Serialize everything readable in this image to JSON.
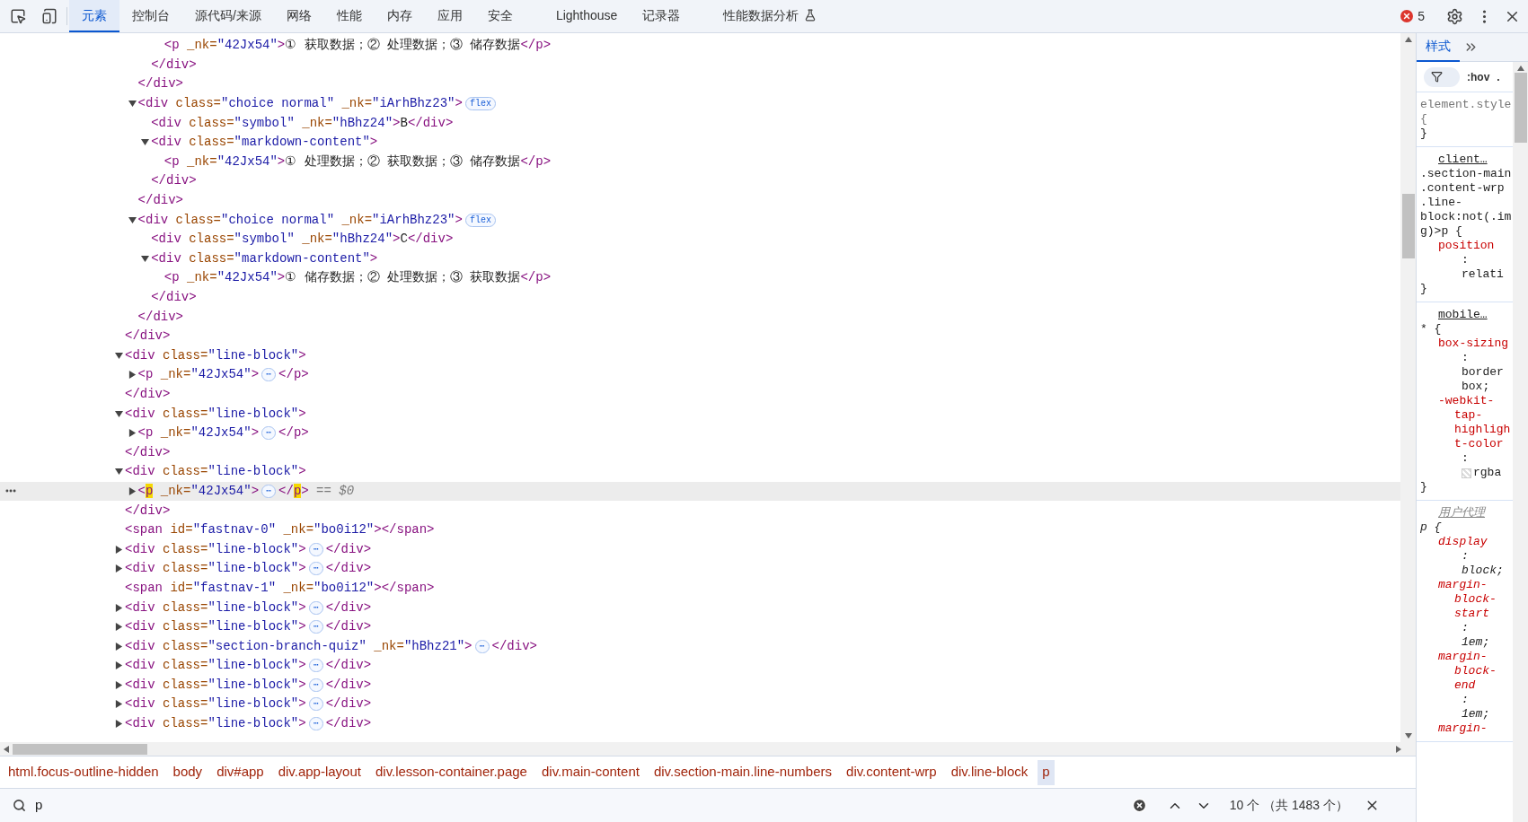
{
  "toolbar": {
    "tabs": [
      {
        "label": "元素",
        "selected": true
      },
      {
        "label": "控制台",
        "selected": false
      },
      {
        "label": "源代码/来源",
        "selected": false
      },
      {
        "label": "网络",
        "selected": false
      },
      {
        "label": "性能",
        "selected": false
      },
      {
        "label": "内存",
        "selected": false
      },
      {
        "label": "应用",
        "selected": false
      },
      {
        "label": "安全",
        "selected": false
      },
      {
        "label": "Lighthouse",
        "selected": false
      },
      {
        "label": "记录器",
        "selected": false
      },
      {
        "label": "性能数据分析",
        "selected": false,
        "experimental": true
      }
    ],
    "error_count": "5"
  },
  "tree": [
    {
      "children": [
        {
          "children": [
            {
              "children": [
                {
                  "selected": false,
                  "tokens": [
                    {
                      "kind": "tag",
                      "text": "<p"
                    },
                    {
                      "kind": "attr",
                      "text": " _nk="
                    },
                    {
                      "kind": "value",
                      "text": "\"42Jx54\""
                    },
                    {
                      "kind": "tag",
                      "text": ">"
                    },
                    {
                      "kind": "text",
                      "text": "① 获取数据；② 处理数据；③ 储存数据"
                    },
                    {
                      "kind": "tag",
                      "text": "</p>"
                    }
                  ]
                }
              ]
            },
            {
              "selected": false,
              "tokens": [
                {
                  "kind": "tag",
                  "text": "</div>"
                }
              ]
            }
          ]
        },
        {
          "selected": false,
          "tokens": [
            {
              "kind": "tag",
              "text": "</div>"
            }
          ]
        },
        {
          "selected": false,
          "expanded": true,
          "tokens": [
            {
              "kind": "tag",
              "text": "<div"
            },
            {
              "kind": "attr",
              "text": " class="
            },
            {
              "kind": "value",
              "text": "\"choice normal\""
            },
            {
              "kind": "attr",
              "text": " _nk="
            },
            {
              "kind": "value",
              "text": "\"iArhBhz23\""
            },
            {
              "kind": "tag",
              "text": ">"
            },
            {
              "kind": "badge",
              "text": "flex"
            }
          ],
          "children": [
            {
              "selected": false,
              "tokens": [
                {
                  "kind": "tag",
                  "text": "<div"
                },
                {
                  "kind": "attr",
                  "text": " class="
                },
                {
                  "kind": "value",
                  "text": "\"symbol\""
                },
                {
                  "kind": "attr",
                  "text": " _nk="
                },
                {
                  "kind": "value",
                  "text": "\"hBhz24\""
                },
                {
                  "kind": "tag",
                  "text": ">"
                },
                {
                  "kind": "text",
                  "text": "B"
                },
                {
                  "kind": "tag",
                  "text": "</div>"
                }
              ]
            },
            {
              "selected": false,
              "expanded": true,
              "tokens": [
                {
                  "kind": "tag",
                  "text": "<div"
                },
                {
                  "kind": "attr",
                  "text": " class="
                },
                {
                  "kind": "value",
                  "text": "\"markdown-content\""
                },
                {
                  "kind": "tag",
                  "text": ">"
                }
              ],
              "children": [
                {
                  "selected": false,
                  "tokens": [
                    {
                      "kind": "tag",
                      "text": "<p"
                    },
                    {
                      "kind": "attr",
                      "text": " _nk="
                    },
                    {
                      "kind": "value",
                      "text": "\"42Jx54\""
                    },
                    {
                      "kind": "tag",
                      "text": ">"
                    },
                    {
                      "kind": "text",
                      "text": "① 处理数据；② 获取数据；③ 储存数据"
                    },
                    {
                      "kind": "tag",
                      "text": "</p>"
                    }
                  ]
                }
              ]
            },
            {
              "selected": false,
              "tokens": [
                {
                  "kind": "tag",
                  "text": "</div>"
                }
              ]
            }
          ]
        },
        {
          "selected": false,
          "tokens": [
            {
              "kind": "tag",
              "text": "</div>"
            }
          ]
        },
        {
          "selected": false,
          "expanded": true,
          "tokens": [
            {
              "kind": "tag",
              "text": "<div"
            },
            {
              "kind": "attr",
              "text": " class="
            },
            {
              "kind": "value",
              "text": "\"choice normal\""
            },
            {
              "kind": "attr",
              "text": " _nk="
            },
            {
              "kind": "value",
              "text": "\"iArhBhz23\""
            },
            {
              "kind": "tag",
              "text": ">"
            },
            {
              "kind": "badge",
              "text": "flex"
            }
          ],
          "children": [
            {
              "selected": false,
              "tokens": [
                {
                  "kind": "tag",
                  "text": "<div"
                },
                {
                  "kind": "attr",
                  "text": " class="
                },
                {
                  "kind": "value",
                  "text": "\"symbol\""
                },
                {
                  "kind": "attr",
                  "text": " _nk="
                },
                {
                  "kind": "value",
                  "text": "\"hBhz24\""
                },
                {
                  "kind": "tag",
                  "text": ">"
                },
                {
                  "kind": "text",
                  "text": "C"
                },
                {
                  "kind": "tag",
                  "text": "</div>"
                }
              ]
            },
            {
              "selected": false,
              "expanded": true,
              "tokens": [
                {
                  "kind": "tag",
                  "text": "<div"
                },
                {
                  "kind": "attr",
                  "text": " class="
                },
                {
                  "kind": "value",
                  "text": "\"markdown-content\""
                },
                {
                  "kind": "tag",
                  "text": ">"
                }
              ],
              "children": [
                {
                  "selected": false,
                  "tokens": [
                    {
                      "kind": "tag",
                      "text": "<p"
                    },
                    {
                      "kind": "attr",
                      "text": " _nk="
                    },
                    {
                      "kind": "value",
                      "text": "\"42Jx54\""
                    },
                    {
                      "kind": "tag",
                      "text": ">"
                    },
                    {
                      "kind": "text",
                      "text": "① 储存数据；② 处理数据；③ 获取数据"
                    },
                    {
                      "kind": "tag",
                      "text": "</p>"
                    }
                  ]
                }
              ]
            },
            {
              "selected": false,
              "tokens": [
                {
                  "kind": "tag",
                  "text": "</div>"
                }
              ]
            }
          ]
        },
        {
          "selected": false,
          "tokens": [
            {
              "kind": "tag",
              "text": "</div>"
            }
          ]
        }
      ]
    },
    {
      "selected": false,
      "tokens": [
        {
          "kind": "tag",
          "text": "</div>"
        }
      ]
    },
    {
      "selected": false,
      "expanded": true,
      "tokens": [
        {
          "kind": "tag",
          "text": "<div"
        },
        {
          "kind": "attr",
          "text": " class="
        },
        {
          "kind": "value",
          "text": "\"line-block\""
        },
        {
          "kind": "tag",
          "text": ">"
        }
      ],
      "children": [
        {
          "selected": false,
          "expanded": false,
          "tokens": [
            {
              "kind": "tag",
              "text": "<p"
            },
            {
              "kind": "attr",
              "text": " _nk="
            },
            {
              "kind": "value",
              "text": "\"42Jx54\""
            },
            {
              "kind": "tag",
              "text": ">"
            },
            {
              "kind": "badge",
              "text": "⋯"
            },
            {
              "kind": "tag",
              "text": "</p>"
            }
          ]
        }
      ]
    },
    {
      "selected": false,
      "tokens": [
        {
          "kind": "tag",
          "text": "</div>"
        }
      ]
    },
    {
      "selected": false,
      "expanded": true,
      "tokens": [
        {
          "kind": "tag",
          "text": "<div"
        },
        {
          "kind": "attr",
          "text": " class="
        },
        {
          "kind": "value",
          "text": "\"line-block\""
        },
        {
          "kind": "tag",
          "text": ">"
        }
      ],
      "children": [
        {
          "selected": false,
          "expanded": false,
          "tokens": [
            {
              "kind": "tag",
              "text": "<p"
            },
            {
              "kind": "attr",
              "text": " _nk="
            },
            {
              "kind": "value",
              "text": "\"42Jx54\""
            },
            {
              "kind": "tag",
              "text": ">"
            },
            {
              "kind": "badge",
              "text": "⋯"
            },
            {
              "kind": "tag",
              "text": "</p>"
            }
          ]
        }
      ]
    },
    {
      "selected": false,
      "tokens": [
        {
          "kind": "tag",
          "text": "</div>"
        }
      ]
    },
    {
      "selected": false,
      "expanded": true,
      "tokens": [
        {
          "kind": "tag",
          "text": "<div"
        },
        {
          "kind": "attr",
          "text": " class="
        },
        {
          "kind": "value",
          "text": "\"line-block\""
        },
        {
          "kind": "tag",
          "text": ">"
        }
      ],
      "children": [
        {
          "selected": true,
          "expanded": false,
          "tokens": [
            {
              "kind": "tag",
              "text": "<"
            },
            {
              "kind": "match",
              "text": "p"
            },
            {
              "kind": "attr",
              "text": " _nk="
            },
            {
              "kind": "value",
              "text": "\"42Jx54\""
            },
            {
              "kind": "tag",
              "text": ">"
            },
            {
              "kind": "badge",
              "text": "⋯"
            },
            {
              "kind": "tag",
              "text": "</"
            },
            {
              "kind": "match",
              "text": "p"
            },
            {
              "kind": "tag",
              "text": ">"
            },
            {
              "kind": "note",
              "text": " == $0"
            }
          ]
        }
      ]
    },
    {
      "selected": false,
      "tokens": [
        {
          "kind": "tag",
          "text": "</div>"
        }
      ]
    },
    {
      "selected": false,
      "tokens": [
        {
          "kind": "tag",
          "text": "<span"
        },
        {
          "kind": "attr",
          "text": " id="
        },
        {
          "kind": "value",
          "text": "\"fastnav-0\""
        },
        {
          "kind": "attr",
          "text": " _nk="
        },
        {
          "kind": "value",
          "text": "\"bo0i12\""
        },
        {
          "kind": "tag",
          "text": "></span>"
        }
      ]
    },
    {
      "selected": false,
      "expanded": false,
      "tokens": [
        {
          "kind": "tag",
          "text": "<div"
        },
        {
          "kind": "attr",
          "text": " class="
        },
        {
          "kind": "value",
          "text": "\"line-block\""
        },
        {
          "kind": "tag",
          "text": ">"
        },
        {
          "kind": "badge",
          "text": "⋯"
        },
        {
          "kind": "tag",
          "text": "</div>"
        }
      ]
    },
    {
      "selected": false,
      "expanded": false,
      "tokens": [
        {
          "kind": "tag",
          "text": "<div"
        },
        {
          "kind": "attr",
          "text": " class="
        },
        {
          "kind": "value",
          "text": "\"line-block\""
        },
        {
          "kind": "tag",
          "text": ">"
        },
        {
          "kind": "badge",
          "text": "⋯"
        },
        {
          "kind": "tag",
          "text": "</div>"
        }
      ]
    },
    {
      "selected": false,
      "tokens": [
        {
          "kind": "tag",
          "text": "<span"
        },
        {
          "kind": "attr",
          "text": " id="
        },
        {
          "kind": "value",
          "text": "\"fastnav-1\""
        },
        {
          "kind": "attr",
          "text": " _nk="
        },
        {
          "kind": "value",
          "text": "\"bo0i12\""
        },
        {
          "kind": "tag",
          "text": "></span>"
        }
      ]
    },
    {
      "selected": false,
      "expanded": false,
      "tokens": [
        {
          "kind": "tag",
          "text": "<div"
        },
        {
          "kind": "attr",
          "text": " class="
        },
        {
          "kind": "value",
          "text": "\"line-block\""
        },
        {
          "kind": "tag",
          "text": ">"
        },
        {
          "kind": "badge",
          "text": "⋯"
        },
        {
          "kind": "tag",
          "text": "</div>"
        }
      ]
    },
    {
      "selected": false,
      "expanded": false,
      "tokens": [
        {
          "kind": "tag",
          "text": "<div"
        },
        {
          "kind": "attr",
          "text": " class="
        },
        {
          "kind": "value",
          "text": "\"line-block\""
        },
        {
          "kind": "tag",
          "text": ">"
        },
        {
          "kind": "badge",
          "text": "⋯"
        },
        {
          "kind": "tag",
          "text": "</div>"
        }
      ]
    },
    {
      "selected": false,
      "expanded": false,
      "tokens": [
        {
          "kind": "tag",
          "text": "<div"
        },
        {
          "kind": "attr",
          "text": " class="
        },
        {
          "kind": "value",
          "text": "\"section-branch-quiz\""
        },
        {
          "kind": "attr",
          "text": " _nk="
        },
        {
          "kind": "value",
          "text": "\"hBhz21\""
        },
        {
          "kind": "tag",
          "text": ">"
        },
        {
          "kind": "badge",
          "text": "⋯"
        },
        {
          "kind": "tag",
          "text": "</div>"
        }
      ]
    },
    {
      "selected": false,
      "expanded": false,
      "tokens": [
        {
          "kind": "tag",
          "text": "<div"
        },
        {
          "kind": "attr",
          "text": " class="
        },
        {
          "kind": "value",
          "text": "\"line-block\""
        },
        {
          "kind": "tag",
          "text": ">"
        },
        {
          "kind": "badge",
          "text": "⋯"
        },
        {
          "kind": "tag",
          "text": "</div>"
        }
      ]
    },
    {
      "selected": false,
      "expanded": false,
      "tokens": [
        {
          "kind": "tag",
          "text": "<div"
        },
        {
          "kind": "attr",
          "text": " class="
        },
        {
          "kind": "value",
          "text": "\"line-block\""
        },
        {
          "kind": "tag",
          "text": ">"
        },
        {
          "kind": "badge",
          "text": "⋯"
        },
        {
          "kind": "tag",
          "text": "</div>"
        }
      ]
    },
    {
      "selected": false,
      "expanded": false,
      "tokens": [
        {
          "kind": "tag",
          "text": "<div"
        },
        {
          "kind": "attr",
          "text": " class="
        },
        {
          "kind": "value",
          "text": "\"line-block\""
        },
        {
          "kind": "tag",
          "text": ">"
        },
        {
          "kind": "badge",
          "text": "⋯"
        },
        {
          "kind": "tag",
          "text": "</div>"
        }
      ]
    },
    {
      "selected": false,
      "expanded": false,
      "tokens": [
        {
          "kind": "tag",
          "text": "<div"
        },
        {
          "kind": "attr",
          "text": " class="
        },
        {
          "kind": "value",
          "text": "\"line-block\""
        },
        {
          "kind": "tag",
          "text": ">"
        },
        {
          "kind": "badge",
          "text": "⋯"
        },
        {
          "kind": "tag",
          "text": "</div>"
        }
      ]
    }
  ],
  "styles": {
    "tabs": [
      {
        "label": "样式",
        "selected": true
      }
    ],
    "filter_buttons": [
      ":hov",
      "."
    ],
    "rules": [
      {
        "kind": "inline",
        "selector": "element.style",
        "open": " {",
        "close": "}"
      },
      {
        "kind": "author",
        "source": "client…",
        "selector": ".section-main .content-wrp .line-block:not(.img)>p",
        "open": " {",
        "declarations": [
          {
            "property": "position",
            "colon": ":",
            "value": "relati"
          }
        ],
        "close": "}"
      },
      {
        "kind": "author",
        "source": "mobile…",
        "selector": "*",
        "open": " {",
        "declarations": [
          {
            "property": "box-sizing",
            "colon": ":",
            "value": "border box;"
          },
          {
            "property": "-webkit-tap-highlight-color",
            "colon": ":",
            "value": "rgba",
            "swatch": true
          }
        ],
        "close": "}"
      },
      {
        "kind": "user_agent",
        "source": "用户代理",
        "selector": "p",
        "open": " {",
        "declarations": [
          {
            "property": "display",
            "colon": ":",
            "value": "block;"
          },
          {
            "property": "margin-block-start",
            "colon": ":",
            "value": "1em;"
          },
          {
            "property": "margin-block-end",
            "colon": ":",
            "value": "1em;"
          },
          {
            "property": "margin-"
          }
        ]
      }
    ]
  },
  "breadcrumbs": [
    {
      "label": "html.focus-outline-hidden",
      "selected": false
    },
    {
      "label": "body",
      "selected": false
    },
    {
      "label": "div#app",
      "selected": false
    },
    {
      "label": "div.app-layout",
      "selected": false
    },
    {
      "label": "div.lesson-container.page",
      "selected": false
    },
    {
      "label": "div.main-content",
      "selected": false
    },
    {
      "label": "div.section-main.line-numbers",
      "selected": false
    },
    {
      "label": "div.content-wrp",
      "selected": false
    },
    {
      "label": "div.line-block",
      "selected": false
    },
    {
      "label": "p",
      "selected": true
    }
  ],
  "search": {
    "value": "p",
    "result": "10 个 （共 1483 个）"
  }
}
